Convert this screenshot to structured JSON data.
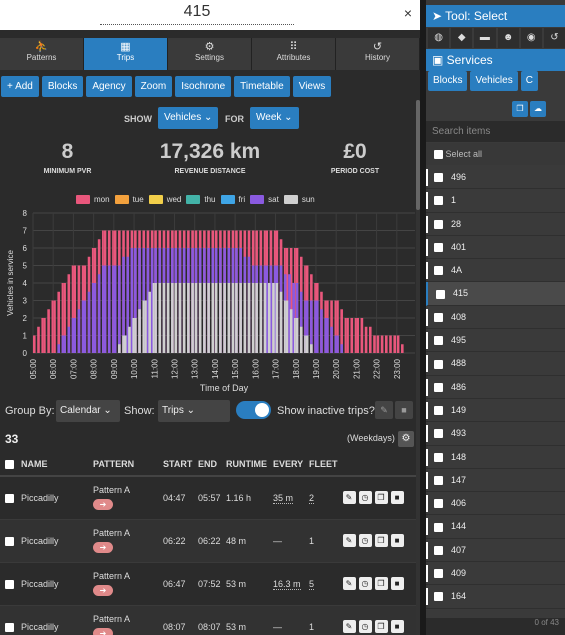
{
  "window": {
    "title": "415",
    "close": "×"
  },
  "tabs": [
    {
      "label": "Patterns",
      "icon": "walk-icon",
      "glyph": "⛹"
    },
    {
      "label": "Trips",
      "icon": "bus-icon",
      "glyph": "▦"
    },
    {
      "label": "Settings",
      "icon": "gear-icon",
      "glyph": "⚙"
    },
    {
      "label": "Attributes",
      "icon": "grid-icon",
      "glyph": "⠿"
    },
    {
      "label": "History",
      "icon": "history-icon",
      "glyph": "↺"
    }
  ],
  "toolbar": [
    "+ Add",
    "Blocks",
    "Agency",
    "Zoom",
    "Isochrone",
    "Timetable",
    "Views"
  ],
  "show": {
    "show_label": "SHOW",
    "show_value": "Vehicles ⌄",
    "for_label": "FOR",
    "for_value": "Week ⌄"
  },
  "stats": [
    {
      "value": "8",
      "label": "MINIMUM PVR"
    },
    {
      "value": "17,326 km",
      "label": "REVENUE DISTANCE"
    },
    {
      "value": "£0",
      "label": "PERIOD COST"
    }
  ],
  "colors": {
    "accent": "#2a7ec0",
    "mon": "#e9577c",
    "tue": "#f3a13d",
    "wed": "#f2cf4a",
    "thu": "#43b3a8",
    "fri": "#3fa5e6",
    "sat": "#8a5ae0",
    "sun": "#cfcfcf"
  },
  "chart_data": {
    "type": "area",
    "xlabel": "Time of Day",
    "ylabel": "Vehicles in service",
    "ylim": [
      0,
      8
    ],
    "yticks": [
      0,
      1,
      2,
      3,
      4,
      5,
      6,
      7,
      8
    ],
    "xticks": [
      "05:00",
      "06:00",
      "07:00",
      "08:00",
      "09:00",
      "10:00",
      "11:00",
      "12:00",
      "13:00",
      "14:00",
      "15:00",
      "16:00",
      "17:00",
      "18:00",
      "19:00",
      "20:00",
      "21:00",
      "22:00",
      "23:00"
    ],
    "series": [
      {
        "name": "mon",
        "profile": [
          [
            5,
            1
          ],
          [
            5.5,
            2
          ],
          [
            6,
            3
          ],
          [
            6.5,
            4
          ],
          [
            7,
            5
          ],
          [
            7.5,
            5
          ],
          [
            8,
            6
          ],
          [
            8.5,
            7
          ],
          [
            9,
            7
          ],
          [
            10,
            7
          ],
          [
            11,
            7
          ],
          [
            12,
            7
          ],
          [
            13,
            7
          ],
          [
            14,
            7
          ],
          [
            15,
            7
          ],
          [
            16,
            7
          ],
          [
            16.5,
            7
          ],
          [
            17,
            7
          ],
          [
            17.5,
            6
          ],
          [
            18,
            6
          ],
          [
            18.5,
            5
          ],
          [
            19,
            4
          ],
          [
            19.5,
            3
          ],
          [
            20,
            3
          ],
          [
            20.5,
            2
          ],
          [
            21,
            2
          ],
          [
            22,
            1
          ],
          [
            23,
            1
          ],
          [
            23.5,
            0
          ]
        ]
      },
      {
        "name": "sat",
        "profile": [
          [
            6,
            0
          ],
          [
            6.5,
            1
          ],
          [
            7,
            2
          ],
          [
            7.5,
            3
          ],
          [
            8,
            4
          ],
          [
            8.5,
            5
          ],
          [
            9,
            5
          ],
          [
            10,
            6
          ],
          [
            11,
            6
          ],
          [
            12,
            6
          ],
          [
            13,
            6
          ],
          [
            14,
            6
          ],
          [
            15,
            6
          ],
          [
            16,
            5
          ],
          [
            16.5,
            5
          ],
          [
            17,
            5
          ],
          [
            18,
            4
          ],
          [
            18.5,
            3
          ],
          [
            19,
            3
          ],
          [
            19.5,
            2
          ],
          [
            20,
            1
          ],
          [
            20.5,
            0
          ]
        ]
      },
      {
        "name": "sun",
        "profile": [
          [
            9,
            0
          ],
          [
            9.5,
            1
          ],
          [
            10,
            2
          ],
          [
            10.5,
            3
          ],
          [
            11,
            4
          ],
          [
            12,
            4
          ],
          [
            13,
            4
          ],
          [
            14,
            4
          ],
          [
            15,
            4
          ],
          [
            16,
            4
          ],
          [
            17,
            4
          ],
          [
            17.5,
            3
          ],
          [
            18,
            2
          ],
          [
            18.5,
            1
          ],
          [
            19,
            0
          ]
        ]
      }
    ],
    "legend": [
      "mon",
      "tue",
      "wed",
      "thu",
      "fri",
      "sat",
      "sun"
    ]
  },
  "filters": {
    "group_label": "Group By:",
    "group_value": "Calendar ⌄",
    "show_label": "Show:",
    "show_value": "Trips ⌄",
    "inactive_label": "Show inactive trips?"
  },
  "trips": {
    "count": "33",
    "calendar": "(Weekdays)"
  },
  "table": {
    "headers": [
      "NAME",
      "PATTERN",
      "START",
      "END",
      "RUNTIME",
      "EVERY",
      "FLEET"
    ],
    "rows": [
      {
        "name": "Piccadilly",
        "pattern": "Pattern A",
        "start": "04:47",
        "end": "05:57",
        "runtime": "1.16 h",
        "every": "35 m",
        "fleet": "2"
      },
      {
        "name": "Piccadilly",
        "pattern": "Pattern A",
        "start": "06:22",
        "end": "06:22",
        "runtime": "48 m",
        "every": "—",
        "fleet": "1"
      },
      {
        "name": "Piccadilly",
        "pattern": "Pattern A",
        "start": "06:47",
        "end": "07:52",
        "runtime": "53 m",
        "every": "16.3 m",
        "fleet": "5"
      },
      {
        "name": "Piccadilly",
        "pattern": "Pattern A",
        "start": "08:07",
        "end": "08:07",
        "runtime": "53 m",
        "every": "—",
        "fleet": "1"
      }
    ]
  },
  "right": {
    "tool": "Tool: Select",
    "services": "Services",
    "tabs": [
      "Blocks",
      "Vehicles",
      "C"
    ],
    "search_placeholder": "Search items",
    "select_all": "Select all",
    "items": [
      "496",
      "1",
      "28",
      "401",
      "4A",
      "415",
      "408",
      "495",
      "488",
      "486",
      "149",
      "493",
      "148",
      "147",
      "406",
      "144",
      "407",
      "409",
      "164"
    ],
    "selected": "415",
    "footer": "0 of 43"
  }
}
